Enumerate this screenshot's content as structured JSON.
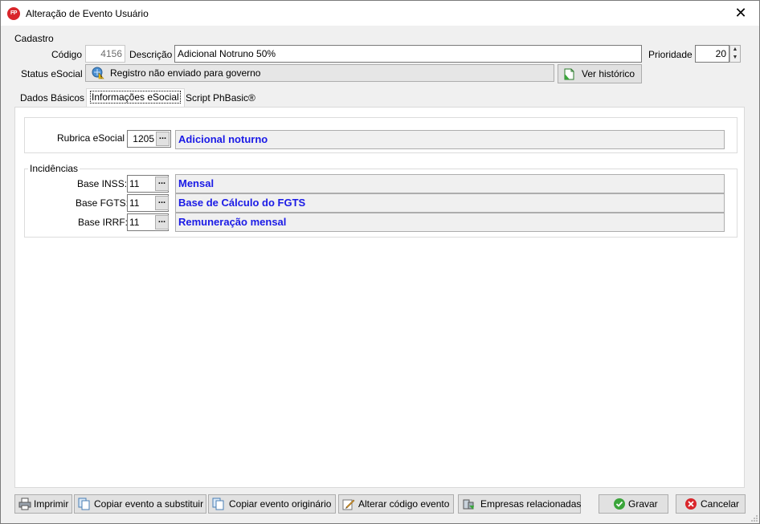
{
  "window": {
    "title": "Alteração de Evento Usuário",
    "app_icon_text": "FP",
    "close_symbol": "✕"
  },
  "cadastro": {
    "group_label": "Cadastro",
    "codigo_label": "Código",
    "codigo_value": "4156",
    "descricao_label": "Descrição",
    "descricao_value": "Adicional Notruno 50%",
    "prioridade_label": "Prioridade",
    "prioridade_value": "20",
    "status_label": "Status eSocial",
    "status_value": "Registro não enviado para governo",
    "historico_button": "Ver histórico"
  },
  "tabs": [
    {
      "label": "Dados Básicos",
      "active": false
    },
    {
      "label": "Informações eSocial",
      "active": true
    },
    {
      "label": "Script PhBasic®",
      "active": false
    }
  ],
  "esocial": {
    "rubrica_label": "Rubrica eSocial",
    "rubrica_code": "1205",
    "rubrica_desc": "Adicional noturno",
    "incidencias_label": "Incidências",
    "rows": [
      {
        "label": "Base INSS:",
        "code": "11",
        "desc": "Mensal"
      },
      {
        "label": "Base FGTS:",
        "code": "11",
        "desc": "Base de Cálculo do FGTS"
      },
      {
        "label": "Base IRRF:",
        "code": "11",
        "desc": "Remuneração mensal"
      }
    ],
    "dots_symbol": "..."
  },
  "footer": {
    "imprimir": "Imprimir",
    "copiar_substituir": "Copiar evento a substituir",
    "copiar_original": "Copiar evento originário",
    "alterar_codigo": "Alterar código evento",
    "empresas": "Empresas relacionadas",
    "gravar": "Gravar",
    "cancelar": "Cancelar"
  },
  "colors": {
    "link_blue": "#1a1ae6",
    "ok_green": "#3aa53a",
    "cancel_red": "#d9262b"
  }
}
